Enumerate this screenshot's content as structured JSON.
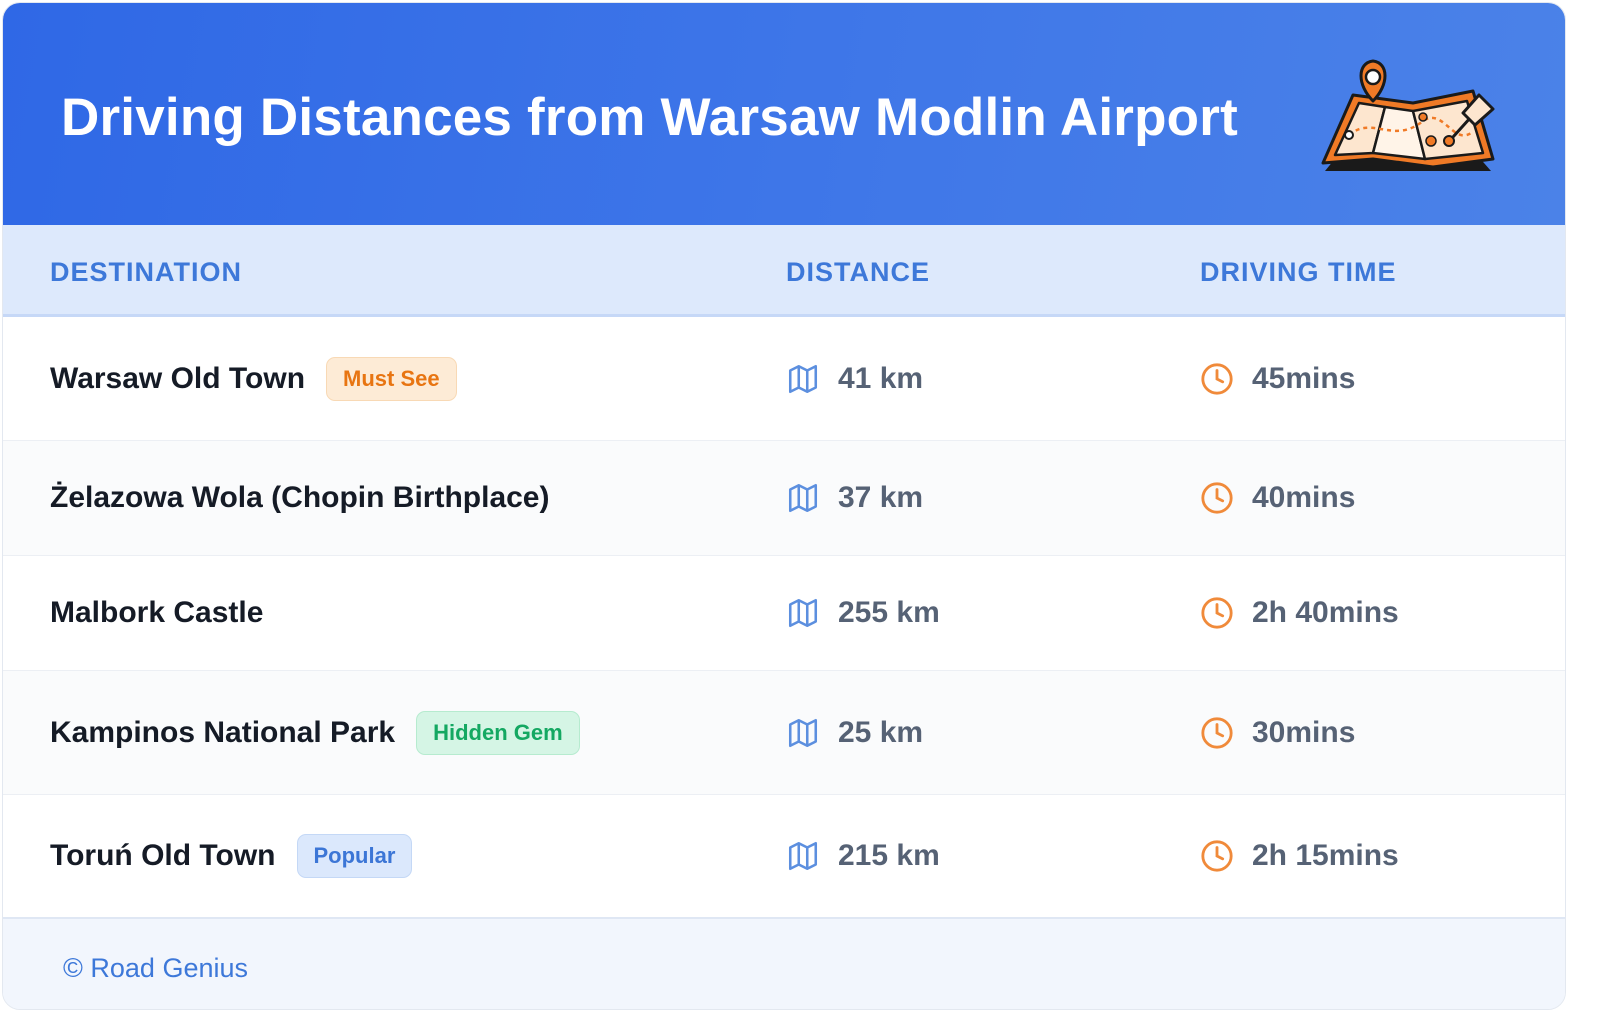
{
  "header": {
    "title": "Driving Distances from Warsaw Modlin Airport",
    "illustration": "map-with-pins-icon"
  },
  "table": {
    "columns": [
      "DESTINATION",
      "DISTANCE",
      "DRIVING TIME"
    ],
    "rows": [
      {
        "destination": "Warsaw Old Town",
        "badge": "Must See",
        "badge_color": "#e87512",
        "distance": "41 km",
        "time": "45mins"
      },
      {
        "destination": "Żelazowa Wola (Chopin Birthplace)",
        "badge": "",
        "distance": "37 km",
        "time": "40mins"
      },
      {
        "destination": "Malbork Castle",
        "badge": "",
        "distance": "255 km",
        "time": "2h 40mins"
      },
      {
        "destination": "Kampinos National Park",
        "badge": "Hidden Gem",
        "badge_color": "#14a862",
        "distance": "25 km",
        "time": "30mins"
      },
      {
        "destination": "Toruń Old Town",
        "badge": "Popular",
        "badge_color": "#3c76d6",
        "distance": "215 km",
        "time": "2h 15mins"
      }
    ],
    "distance_icon": "map-icon",
    "time_icon": "clock-icon"
  },
  "footer": {
    "text": "© Road Genius"
  },
  "colors": {
    "header_bg": "#3470e6",
    "accent": "#3d78d9",
    "icon_orange": "#f08a3a"
  }
}
